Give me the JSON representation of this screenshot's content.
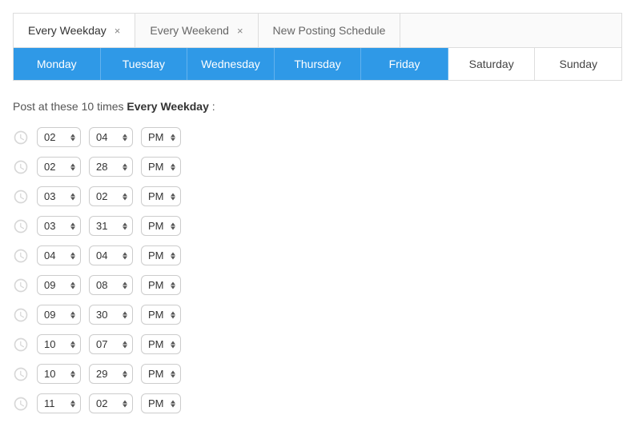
{
  "tabs": [
    {
      "label": "Every Weekday",
      "closable": true,
      "active": true
    },
    {
      "label": "Every Weekend",
      "closable": true,
      "active": false
    },
    {
      "label": "New Posting Schedule",
      "closable": false,
      "active": false
    }
  ],
  "days": [
    {
      "label": "Monday",
      "active": true
    },
    {
      "label": "Tuesday",
      "active": true
    },
    {
      "label": "Wednesday",
      "active": true
    },
    {
      "label": "Thursday",
      "active": true
    },
    {
      "label": "Friday",
      "active": true
    },
    {
      "label": "Saturday",
      "active": false
    },
    {
      "label": "Sunday",
      "active": false
    }
  ],
  "heading": {
    "prefix": "Post at these 10 times ",
    "bold": "Every Weekday",
    "suffix": " :"
  },
  "times": [
    {
      "hour": "02",
      "minute": "04",
      "ampm": "PM"
    },
    {
      "hour": "02",
      "minute": "28",
      "ampm": "PM"
    },
    {
      "hour": "03",
      "minute": "02",
      "ampm": "PM"
    },
    {
      "hour": "03",
      "minute": "31",
      "ampm": "PM"
    },
    {
      "hour": "04",
      "minute": "04",
      "ampm": "PM"
    },
    {
      "hour": "09",
      "minute": "08",
      "ampm": "PM"
    },
    {
      "hour": "09",
      "minute": "30",
      "ampm": "PM"
    },
    {
      "hour": "10",
      "minute": "07",
      "ampm": "PM"
    },
    {
      "hour": "10",
      "minute": "29",
      "ampm": "PM"
    },
    {
      "hour": "11",
      "minute": "02",
      "ampm": "PM"
    }
  ],
  "close_glyph": "×"
}
